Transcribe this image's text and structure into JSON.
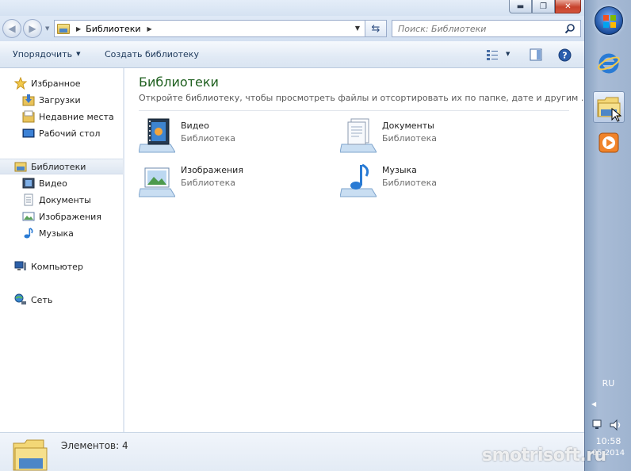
{
  "window": {
    "caption_buttons": {
      "minimize": "minimize-icon",
      "maximize": "restore-icon",
      "close": "close-icon"
    }
  },
  "address": {
    "breadcrumb": "Библиотеки",
    "search_placeholder": "Поиск: Библиотеки"
  },
  "toolbar": {
    "organize": "Упорядочить",
    "create_library": "Создать библиотеку"
  },
  "navpane": {
    "favorites": {
      "title": "Избранное",
      "items": [
        "Загрузки",
        "Недавние места",
        "Рабочий стол"
      ]
    },
    "libraries": {
      "title": "Библиотеки",
      "items": [
        "Видео",
        "Документы",
        "Изображения",
        "Музыка"
      ]
    },
    "computer": "Компьютер",
    "network": "Сеть"
  },
  "content": {
    "title": "Библиотеки",
    "subtitle": "Откройте библиотеку, чтобы просмотреть файлы и отсортировать их по папке, дате и другим ...",
    "libraries": [
      {
        "name": "Видео",
        "kind": "Библиотека"
      },
      {
        "name": "Документы",
        "kind": "Библиотека"
      },
      {
        "name": "Изображения",
        "kind": "Библиотека"
      },
      {
        "name": "Музыка",
        "kind": "Библиотека"
      }
    ]
  },
  "details": {
    "count_text": "Элементов: 4"
  },
  "taskbar": {
    "language": "RU",
    "time": "10:58",
    "date": "05.2014"
  },
  "watermark": "smotrisoft.ru",
  "colors": {
    "title_green": "#1e5f1e",
    "toolbar_text": "#1e395b",
    "taskbar": "#9fb4d0"
  }
}
